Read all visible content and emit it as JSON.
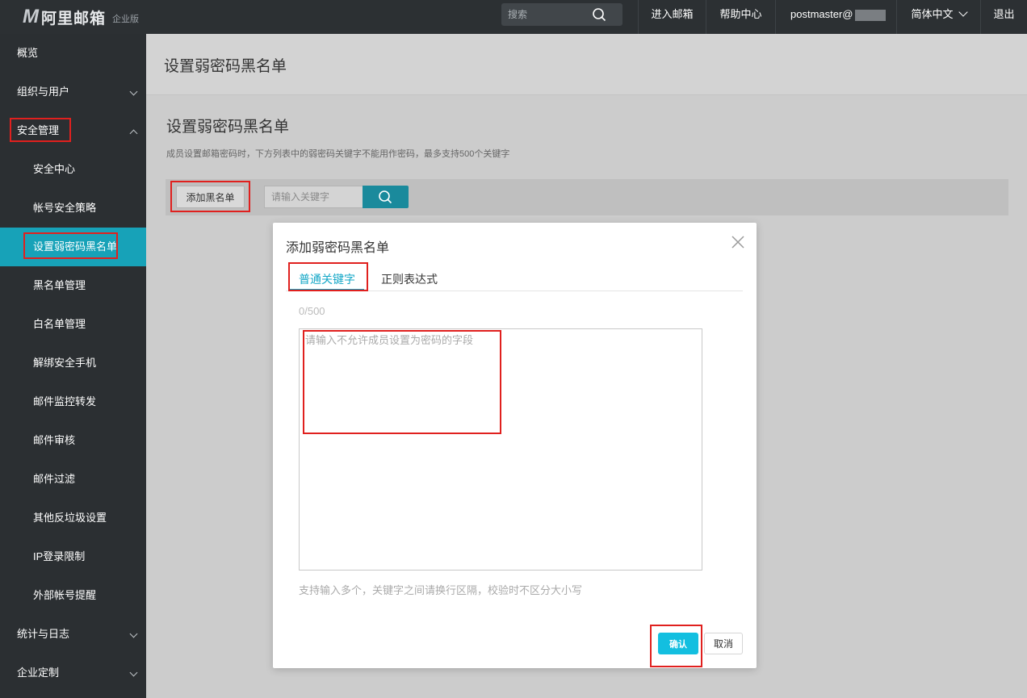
{
  "topbar": {
    "logo_mark": "M",
    "logo_text": "阿里邮箱",
    "edition": "企业版",
    "search_placeholder": "搜索",
    "nav_enter": "进入邮箱",
    "nav_help": "帮助中心",
    "user": "postmaster@",
    "lang": "简体中文",
    "logout": "退出"
  },
  "sidebar": {
    "overview": "概览",
    "org": "组织与用户",
    "security": "安全管理",
    "sub": [
      "安全中心",
      "帐号安全策略",
      "设置弱密码黑名单",
      "黑名单管理",
      "白名单管理",
      "解绑安全手机",
      "邮件监控转发",
      "邮件审核",
      "邮件过滤",
      "其他反垃圾设置",
      "IP登录限制",
      "外部帐号提醒"
    ],
    "stats": "统计与日志",
    "custom": "企业定制"
  },
  "main": {
    "page_title": "设置弱密码黑名单",
    "section_title": "设置弱密码黑名单",
    "description": "成员设置邮箱密码时，下方列表中的弱密码关键字不能用作密码，最多支持500个关键字",
    "add_button": "添加黑名单",
    "keyword_placeholder": "请输入关键字"
  },
  "modal": {
    "title": "添加弱密码黑名单",
    "tab_normal": "普通关键字",
    "tab_regex": "正则表达式",
    "counter": "0/500",
    "textarea_placeholder": "请输入不允许成员设置为密码的字段",
    "hint": "支持输入多个，关键字之间请换行区隔，校验时不区分大小写",
    "confirm": "确认",
    "cancel": "取消"
  },
  "colors": {
    "topbar_bg": "#2c3033",
    "sidebar_bg": "#2b2f32",
    "active_bg": "#17a2b8",
    "accent": "#13a7c7",
    "confirm_bg": "#13bfe0",
    "highlight": "#e0201e"
  }
}
